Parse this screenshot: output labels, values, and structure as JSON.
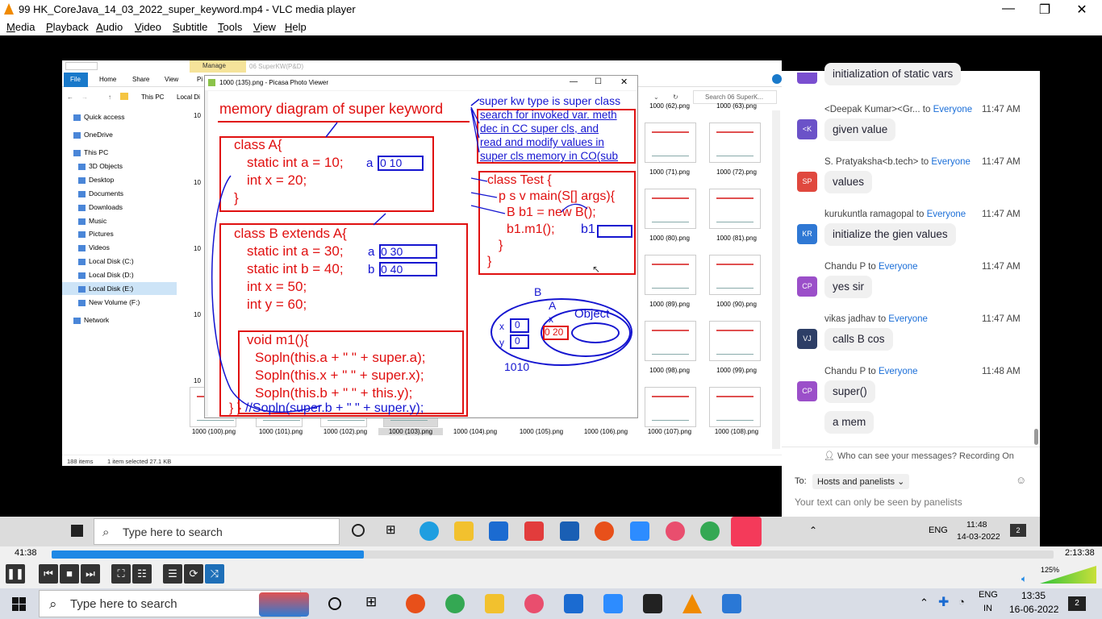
{
  "window": {
    "title": "99 HK_CoreJava_14_03_2022_super_keyword.mp4 - VLC media player",
    "minimize": "—",
    "maximize": "❐",
    "close": "✕"
  },
  "menu": [
    "Media",
    "Playback",
    "Audio",
    "Video",
    "Subtitle",
    "Tools",
    "View",
    "Help"
  ],
  "explorer": {
    "tab_manage": "Manage",
    "tab_path": "06 SuperKW(P&D)",
    "ribbon": [
      "File",
      "Home",
      "Share",
      "View",
      "Pi"
    ],
    "address": [
      "This PC",
      "Local Di"
    ],
    "search_placeholder": "Search 06 SuperK...",
    "nav": [
      "Quick access",
      "OneDrive",
      "This PC",
      "3D Objects",
      "Desktop",
      "Documents",
      "Downloads",
      "Music",
      "Pictures",
      "Videos",
      "Local Disk (C:)",
      "Local Disk (D:)",
      "Local Disk (E:)",
      "New Volume (F:)",
      "Network"
    ],
    "thumb_labels_right": [
      "1000 (62).png",
      "1000 (63).png",
      "1000 (71).png",
      "1000 (72).png",
      "1000 (80).png",
      "1000 (81).png",
      "1000 (89).png",
      "1000 (90).png",
      "1000 (98).png",
      "1000 (99).png"
    ],
    "thumb_labels_bottom": [
      "1000 (100).png",
      "1000 (101).png",
      "1000 (102).png",
      "1000 (103).png",
      "1000 (104).png",
      "1000 (105).png",
      "1000 (106).png",
      "1000 (107).png",
      "1000 (108).png"
    ],
    "left_numbers": [
      "10",
      "10",
      "10",
      "10",
      "10"
    ],
    "status_count": "188 items",
    "status_selected": "1 item selected  27.1 KB"
  },
  "picasa": {
    "title": "1000 (135).png - Picasa Photo Viewer",
    "slide": {
      "heading": "memory diagram of super keyword",
      "note1": "super kw type is super class",
      "note2": "search for invoked var. meth",
      "note3": "dec in CC super cls, and",
      "note4": "read and modify values in",
      "note5": "super cls memory in CO(sub",
      "classA": [
        "class A{",
        "static int a = 10;",
        "int x = 20;",
        "}"
      ],
      "classA_a_label": "a",
      "classA_a_val": "0 10",
      "classB": [
        "class B extends A{",
        "static int a = 30;",
        "static int b = 40;",
        "int x = 50;",
        "int y = 60;"
      ],
      "classB_a_label": "a",
      "classB_a_val": "0 30",
      "classB_b_label": "b",
      "classB_b_val": "0 40",
      "m1": [
        "void m1(){",
        "Sopln(this.a + \" \" + super.a);",
        "Sopln(this.x + \" \" + super.x);",
        "Sopln(this.b + \" \" + this.y);",
        "//Sopln(super.b + \" \" + super.y);"
      ],
      "m1_close": "} }",
      "test": [
        "class Test {",
        "p s v main(S[] args){",
        "B b1 = new B();",
        "b1.m1();",
        "}",
        "}"
      ],
      "test_b1": "b1",
      "obj_B": "B",
      "obj_A": "A",
      "obj_x_outer": "x",
      "obj_y_outer": "y",
      "obj_x_val": "0",
      "obj_y_val": "0",
      "obj_x_inner": "x",
      "obj_x_inner_val": "0 20",
      "obj_object": "Object",
      "obj_addr": "1010"
    }
  },
  "chat": {
    "top_fragment": "initialization of static vars",
    "messages": [
      {
        "initials": "<K",
        "color": "#6b52c8",
        "sender": "<Deepak Kumar><Gr...",
        "to": "Everyone",
        "time": "11:47 AM",
        "text": "given value"
      },
      {
        "initials": "SP",
        "color": "#e0483e",
        "sender": "S. Pratyaksha<b.tech>",
        "to": "Everyone",
        "time": "11:47 AM",
        "text": "values"
      },
      {
        "initials": "KR",
        "color": "#2f78d4",
        "sender": "kurukuntla ramagopal",
        "to": "Everyone",
        "time": "11:47 AM",
        "text": "initialize the gien values"
      },
      {
        "initials": "CP",
        "color": "#9b4fc9",
        "sender": "Chandu P",
        "to": "Everyone",
        "time": "11:47 AM",
        "text": "yes sir"
      },
      {
        "initials": "VJ",
        "color": "#2d3e66",
        "sender": "vikas jadhav",
        "to": "Everyone",
        "time": "11:47 AM",
        "text": "calls B cos"
      },
      {
        "initials": "CP",
        "color": "#9b4fc9",
        "sender": "Chandu P",
        "to": "Everyone",
        "time": "11:48 AM",
        "text": "super()"
      }
    ],
    "extra_bubble": "a mem",
    "to_word": "to",
    "privacy": "Who can see your messages? Recording On",
    "to_label": "To:",
    "to_select": "Hosts and panelists",
    "placeholder": "Your text can only be seen by panelists"
  },
  "inner_taskbar": {
    "search": "Type here to search",
    "lang": "ENG",
    "time": "11:48",
    "date": "14-03-2022",
    "notif": "2"
  },
  "player": {
    "elapsed": "41:38",
    "total": "2:13:38",
    "progress": 0.3112,
    "volume": "125%"
  },
  "taskbar": {
    "search": "Type here to search",
    "lang": "ENG",
    "region": "IN",
    "time": "13:35",
    "date": "16-06-2022",
    "notif": "2"
  }
}
